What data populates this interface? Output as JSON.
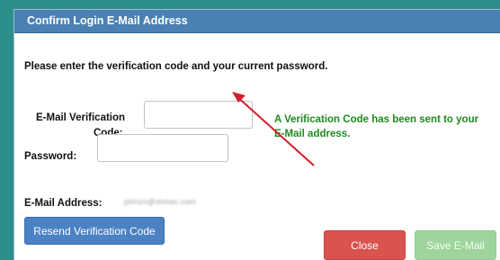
{
  "dialog": {
    "title": "Confirm Login E-Mail Address",
    "instruction": "Please enter the verification code and your current password.",
    "code_label_line1": "E-Mail Verification",
    "code_label_line2": "Code:",
    "code_value": "",
    "password_label": "Password:",
    "password_value": "",
    "email_label": "E-Mail Address:",
    "email_value": "jshnzn@shmec.com",
    "notice_line1": "A Verification Code has been sent to your",
    "notice_line2": "E-Mail address.",
    "resend_button": "Resend Verification Code",
    "close_button": "Close",
    "save_button": "Save E-Mail"
  },
  "colors": {
    "background": "#2c8f8b",
    "titlebar": "#4a80b2",
    "notice_text": "#1f8a1f",
    "arrow": "#d0202a",
    "resend_button": "#4b82c3",
    "close_button": "#d9534f",
    "save_button": "#9ed59c"
  }
}
